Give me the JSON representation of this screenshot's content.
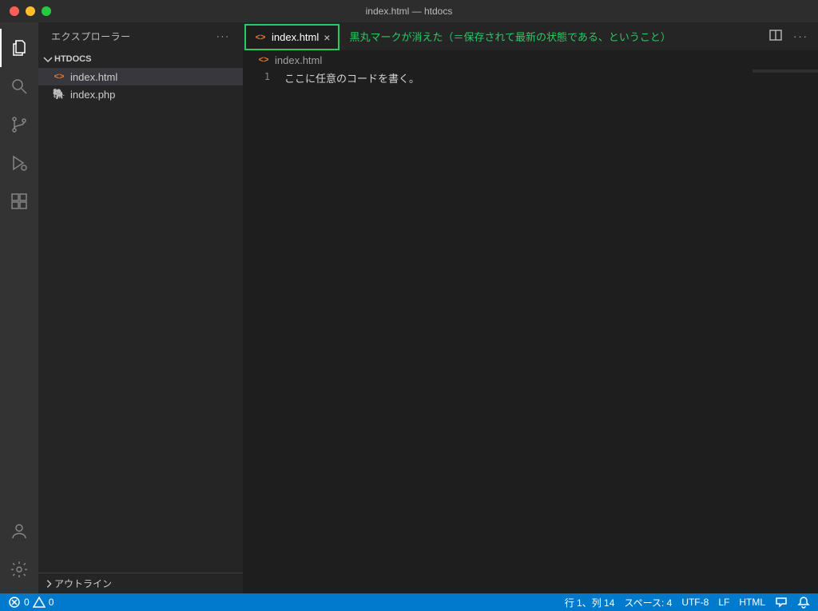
{
  "titlebar": {
    "title": "index.html — htdocs"
  },
  "sidebar": {
    "title": "エクスプローラー",
    "project": "HTDOCS",
    "files": [
      {
        "name": "index.html",
        "icon": "html"
      },
      {
        "name": "index.php",
        "icon": "php"
      }
    ],
    "outline_label": "アウトライン"
  },
  "tabs": {
    "active": {
      "name": "index.html"
    },
    "annotation": "黒丸マークが消えた（＝保存されて最新の状態である、ということ）"
  },
  "breadcrumb": {
    "file": "index.html"
  },
  "editor": {
    "lines": [
      {
        "num": "1",
        "text": "ここに任意のコードを書く。"
      }
    ]
  },
  "statusbar": {
    "errors": "0",
    "warnings": "0",
    "line_col": "行 1、列 14",
    "spaces": "スペース: 4",
    "encoding": "UTF-8",
    "eol": "LF",
    "language": "HTML"
  }
}
